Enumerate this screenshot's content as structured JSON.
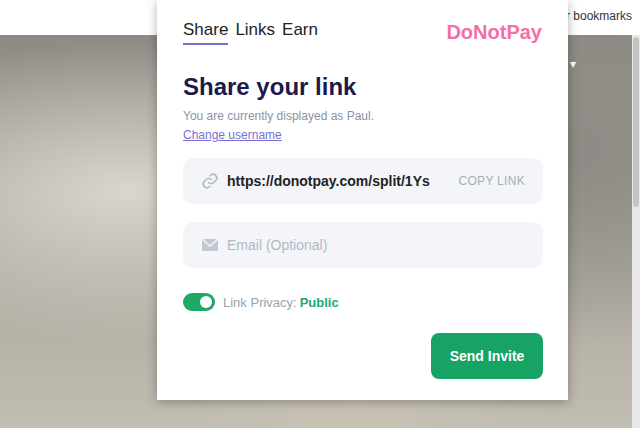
{
  "browser": {
    "bookmarks_label": "er bookmarks",
    "menu_arrow": "▾"
  },
  "popup": {
    "tabs": [
      {
        "label": "Share",
        "selected": true
      },
      {
        "label": "Links",
        "selected": false
      },
      {
        "label": "Earn",
        "selected": false
      }
    ],
    "logo": "DoNotPay",
    "heading": "Share your link",
    "subtitle": "You are currently displayed as Paul.",
    "change_username": "Change username",
    "link_field": {
      "value": "https://donotpay.com/split/1Ys",
      "copy_button": "COPY LINK"
    },
    "email_field": {
      "placeholder": "Email (Optional)"
    },
    "privacy": {
      "on": true,
      "label": "Link Privacy:",
      "value": "Public"
    },
    "send_button": "Send Invite"
  }
}
